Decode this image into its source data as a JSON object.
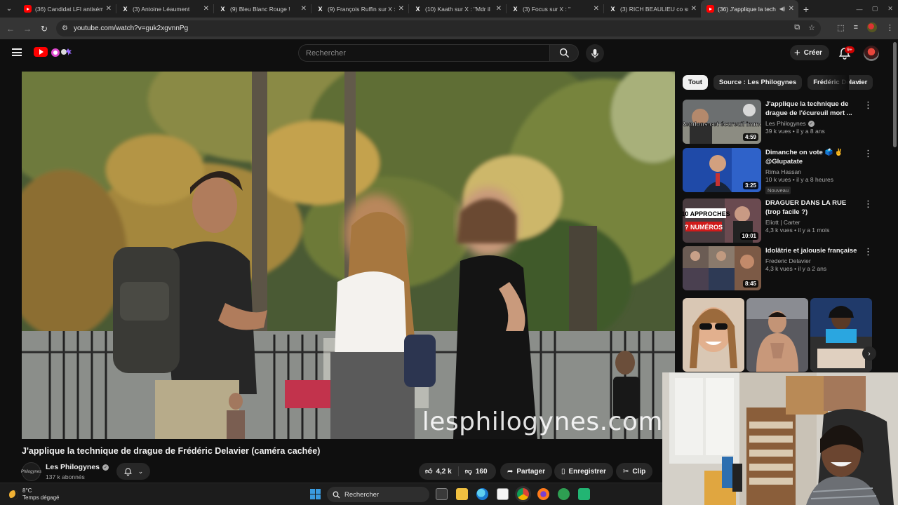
{
  "browser": {
    "tabs": [
      {
        "title": "(36) Candidat LFI antisém",
        "favicon": "youtube-icon"
      },
      {
        "title": "(3) Antoine Léaument",
        "favicon": "x-icon"
      },
      {
        "title": "(9) Bleu Blanc Rouge !",
        "favicon": "x-icon"
      },
      {
        "title": "(9) François Ruffin sur X :",
        "favicon": "x-icon"
      },
      {
        "title": "(10) Kaath sur X : \"Mdr il",
        "favicon": "x-icon"
      },
      {
        "title": "(3) Focus sur X : \"",
        "favicon": "x-icon"
      },
      {
        "title": "(3) RICH BEAULIEU co sur",
        "favicon": "x-icon"
      },
      {
        "title": "(36) J'applique la tech",
        "favicon": "youtube-icon",
        "active": true
      }
    ],
    "url": "youtube.com/watch?v=guk2xgvnnPg"
  },
  "header": {
    "search_placeholder": "Rechercher",
    "create_label": "Créer",
    "notifications_count": "9+"
  },
  "chips": [
    "Tout",
    "Source : Les Philogynes",
    "Frédéric Delavier"
  ],
  "video": {
    "title": "J'applique la technique de drague de Frédéric Delavier (caméra cachée)",
    "watermark": "lesphilogynes.com",
    "channel": {
      "name": "Les Philogynes",
      "subscribers": "137 k abonnés",
      "avatar_text": "Philogynes"
    },
    "likes": "4,2 k",
    "dislikes": "160",
    "actions": {
      "share": "Partager",
      "save": "Enregistrer",
      "clip": "Clip"
    }
  },
  "recommendations": [
    {
      "title": "J'applique la technique de drague de l'écureuil mort ...",
      "channel": "Les Philogynes",
      "verified": true,
      "meta": "39 k vues • il y a 8 ans",
      "duration": "4:59",
      "badge": ""
    },
    {
      "title": "Dimanche on vote 🗳️ ✌️ @Glupatate",
      "channel": "Rima Hassan",
      "verified": false,
      "meta": "10 k vues • il y a 8 heures",
      "duration": "3:25",
      "badge": "Nouveau"
    },
    {
      "title": "DRAGUER DANS LA RUE (trop facile ?)",
      "channel": "Eliott | Carter",
      "verified": false,
      "meta": "4,3 k vues • il y a 1 mois",
      "duration": "10:01",
      "badge": ""
    },
    {
      "title": "Idolâtrie et jalousie française",
      "channel": "Frederic Delavier",
      "verified": false,
      "meta": "4,3 k vues • il y a 2 ans",
      "duration": "8:45",
      "badge": ""
    }
  ],
  "thumb_texts": {
    "rec1": "Rendons cet écureuil immo",
    "rec3_top": "10 APPROCHES",
    "rec3_bottom": "? NUMÉROS"
  },
  "taskbar": {
    "temperature": "8°C",
    "weather": "Temps dégagé",
    "search_label": "Rechercher"
  },
  "colors": {
    "background": "#0f0f0f",
    "youtube_red": "#ff0000",
    "chip_bg": "#272727",
    "text_secondary": "#aaaaaa"
  }
}
